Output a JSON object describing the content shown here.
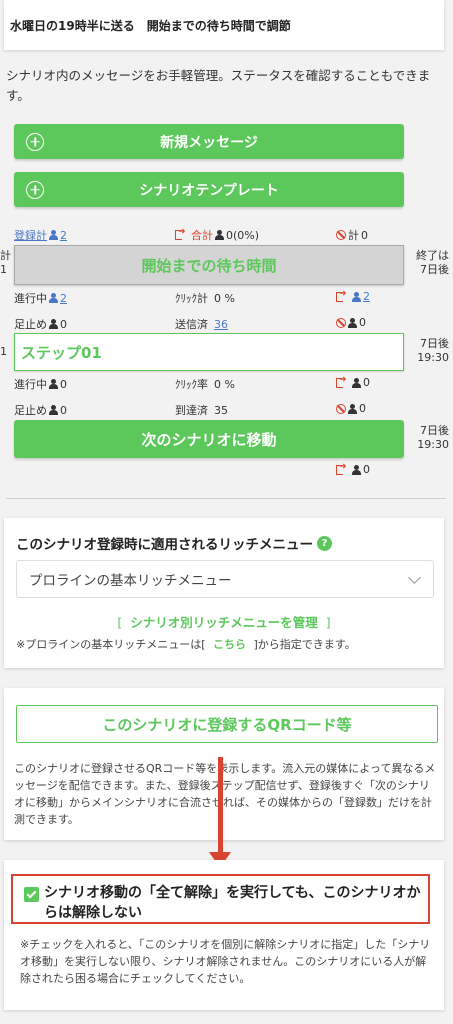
{
  "header": {
    "title": "水曜日の19時半に送る　開始までの待ち時間で調節"
  },
  "intro": {
    "text": "シナリオ内のメッセージをお手軽管理。ステータスを確認することもできます。"
  },
  "buttons": {
    "new_message": "新規メッセージ",
    "template": "シナリオテンプレート",
    "next_scenario": "次のシナリオに移動"
  },
  "summary": {
    "registered_label": "登録計",
    "registered_value": "2",
    "total_label": "合計",
    "total_value": "0(0%)",
    "ban_label": "計",
    "ban_value": "0"
  },
  "wait": {
    "label": "開始までの待ち時間",
    "left_partial": "計",
    "left_partial2": "1",
    "right_line1": "終了は",
    "right_line2": "7日後"
  },
  "wait_stats": {
    "in_progress_label": "進行中",
    "in_progress": "2",
    "click_label": "ｸﾘｯｸ計",
    "click": "0 %",
    "exit": "2",
    "stop_label": "足止め",
    "stop": "0",
    "sent_label": "送信済",
    "sent": "36",
    "ban": "0"
  },
  "step": {
    "label": "ステップ01",
    "left_partial": "1",
    "right_line1": "7日後",
    "right_line2": "19:30"
  },
  "step_stats": {
    "in_progress_label": "進行中",
    "in_progress": "0",
    "click_label": "ｸﾘｯｸ率",
    "click": "0 %",
    "exit": "0",
    "stop_label": "足止め",
    "stop": "0",
    "reached_label": "到達済",
    "reached": "35",
    "ban": "0"
  },
  "next": {
    "right_line1": "7日後",
    "right_line2": "19:30",
    "exit": "0"
  },
  "rich_menu": {
    "title": "このシナリオ登録時に適用されるリッチメニュー",
    "help": "?",
    "select_value": "プロラインの基本リッチメニュー",
    "manage_prefix": "[",
    "manage_link": "シナリオ別リッチメニューを管理",
    "manage_suffix": "]",
    "note_prefix": "※プロラインの基本リッチメニューは[",
    "note_link": "こちら",
    "note_suffix": "]から指定できます。"
  },
  "qr": {
    "button": "このシナリオに登録するQRコード等",
    "desc": "このシナリオに登録させるQRコード等を表示します。流入元の媒体によって異なるメッセージを配信できます。また、登録後ステップ配信せず、登録後すぐ「次のシナリオに移動」からメインシナリオに合流させれば、その媒体からの「登録数」だけを計測できます。"
  },
  "option": {
    "checkbox_label": "シナリオ移動の「全て解除」を実行しても、このシナリオからは解除しない",
    "note": "※チェックを入れると、「このシナリオを個別に解除シナリオに指定」した「シナリオ移動」を実行しない限り、シナリオ解除されません。このシナリオにいる人が解除されたら困る場合にチェックしてください。"
  },
  "colors": {
    "green": "#5cc85c",
    "red": "#d9442f",
    "blue": "#4a78c8",
    "highlight": "#d9442f"
  }
}
